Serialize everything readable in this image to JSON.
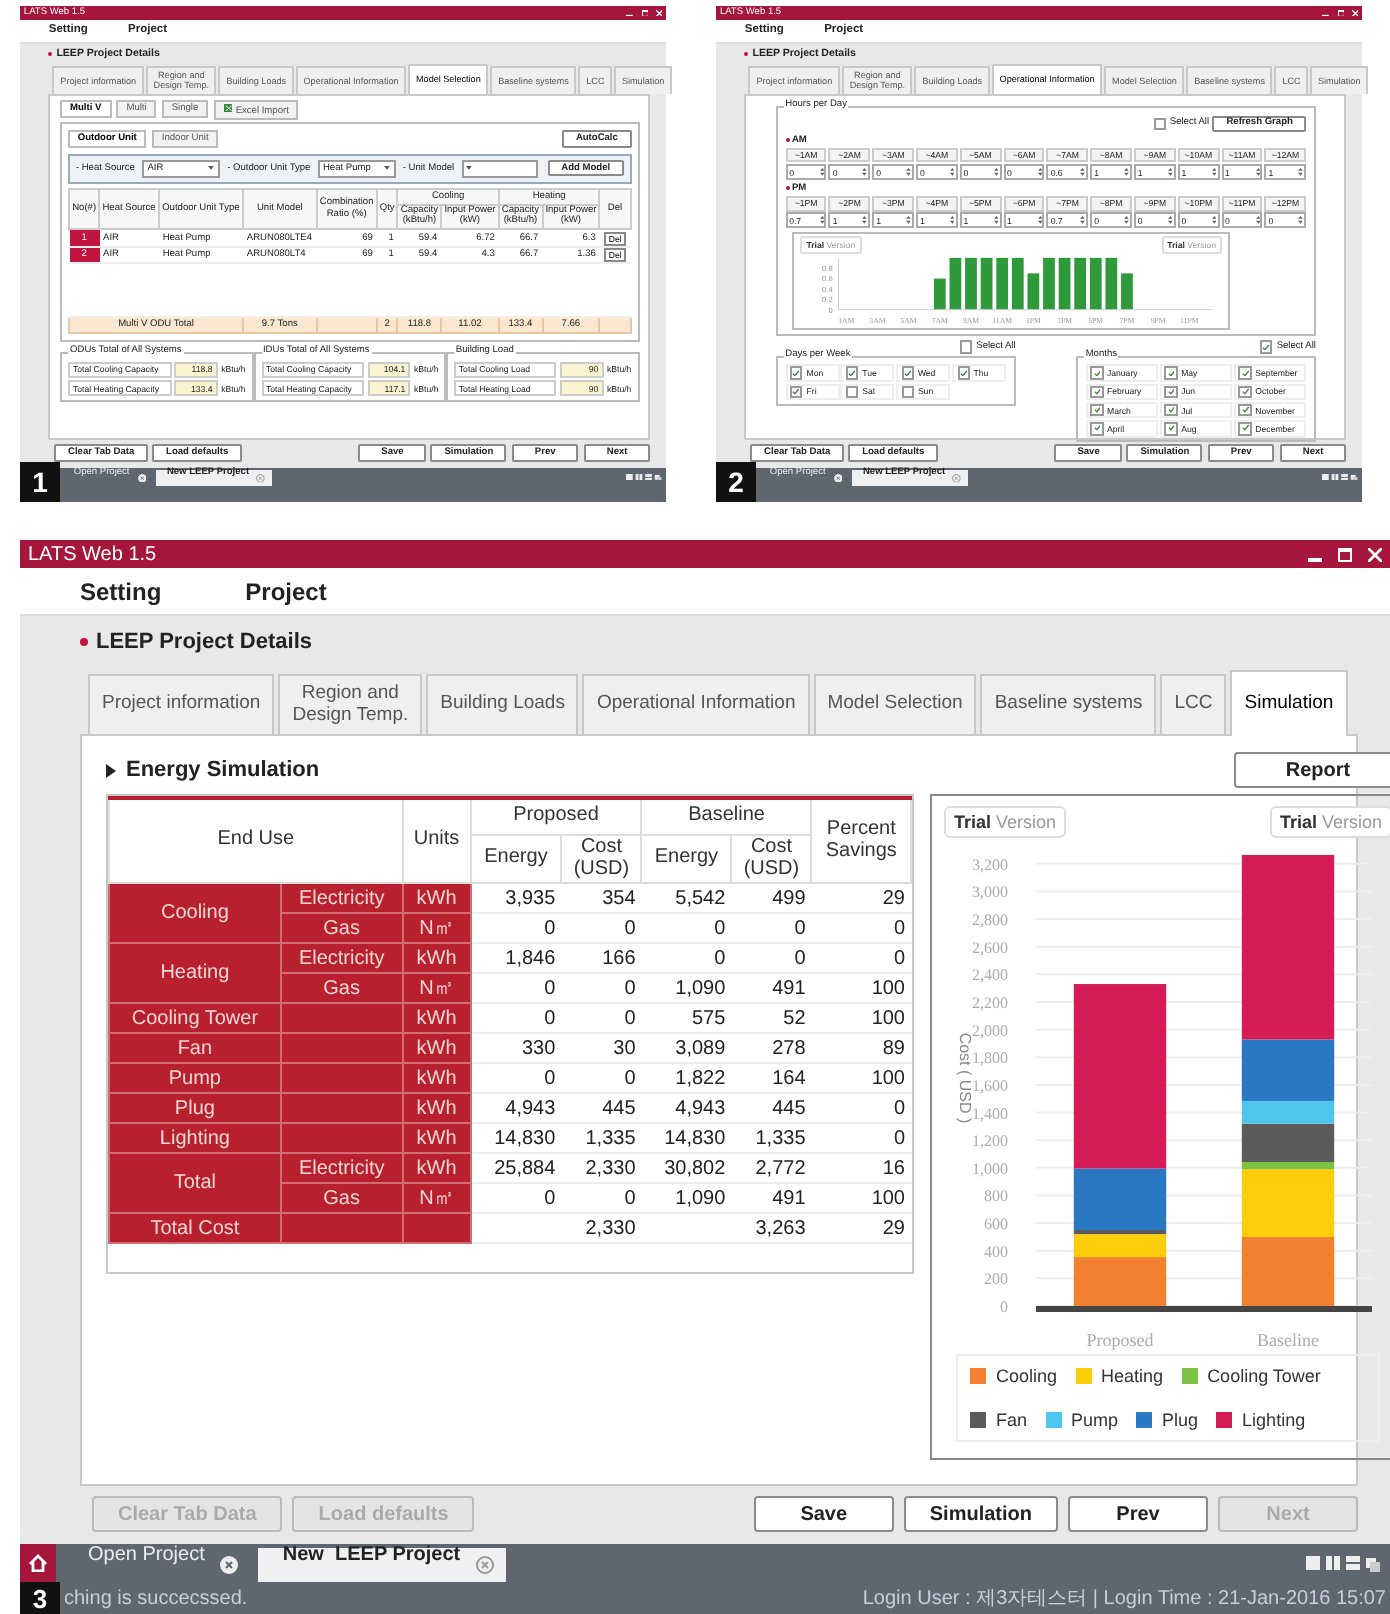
{
  "screens": [
    {
      "number": "1",
      "window": {
        "title": "LATS Web 1.5"
      },
      "menu": [
        "Setting",
        "Project"
      ],
      "section_title": "LEEP Project Details",
      "tabs": [
        {
          "label": "Project information",
          "selected": false
        },
        {
          "label": "Region and\nDesign Temp.",
          "selected": false
        },
        {
          "label": "Building Loads",
          "selected": false
        },
        {
          "label": "Operational Information",
          "selected": false
        },
        {
          "label": "Model Selection",
          "selected": true
        },
        {
          "label": "Baseline systems",
          "selected": false
        },
        {
          "label": "LCC",
          "selected": false
        },
        {
          "label": "Simulation",
          "selected": false
        }
      ],
      "content": {
        "kind": "model_selection",
        "subtabs": [
          {
            "label": "Multi V",
            "selected": true
          },
          {
            "label": "Multi",
            "selected": false
          },
          {
            "label": "Single",
            "selected": false
          }
        ],
        "excel_button": "Excel Import",
        "unit_tabs": [
          {
            "label": "Outdoor Unit",
            "selected": true
          },
          {
            "label": "Indoor Unit",
            "selected": false
          }
        ],
        "autocalc_button": "AutoCalc",
        "filters": [
          {
            "label": "- Heat Source",
            "value": "AIR"
          },
          {
            "label": "- Outdoor Unit Type",
            "value": "Heat Pump"
          },
          {
            "label": "- Unit Model"
          }
        ],
        "add_button": "Add Model",
        "columns": [
          "No(#)",
          "Heat Source",
          "Outdoor Unit Type",
          "Unit Model",
          "Combination\nRatio (%)",
          "Qty"
        ],
        "column_groups": [
          {
            "label": "Cooling",
            "columns": [
              "Capacity\n(kBtu/h)",
              "Input Power\n(kW)"
            ]
          },
          {
            "label": "Heating",
            "columns": [
              "Capacity\n(kBtu/h)",
              "Input Power\n(kW)"
            ]
          }
        ],
        "del_column": "Del",
        "rows": [
          {
            "cells": [
              "1",
              "AIR",
              "Heat Pump",
              "ARUN080LTE4",
              "69",
              "1",
              "59.4",
              "6.72",
              "66.7",
              "6.3"
            ],
            "action": "Del"
          },
          {
            "cells": [
              "2",
              "AIR",
              "Heat Pump",
              "ARUN080LT4",
              "69",
              "1",
              "59.4",
              "4.3",
              "66.7",
              "1.36"
            ],
            "action": "Del"
          }
        ],
        "total": {
          "label": "Multi V  ODU  Total",
          "unit_model": "9.7 Tons",
          "qty": "2",
          "cooling_capacity": "118.8",
          "cooling_power": "11.02",
          "heating_capacity": "133.4",
          "heating_power": "7.66"
        },
        "summaries": [
          {
            "title": "ODUs Total of All Systems",
            "fields": [
              {
                "label": "Total Cooling Capacity",
                "value": "118.8",
                "unit": "kBtu/h"
              },
              {
                "label": "Total Heating Capacity",
                "value": "133.4",
                "unit": "kBtu/h"
              }
            ]
          },
          {
            "title": "IDUs Total of All Systems",
            "fields": [
              {
                "label": "Total Cooling Capacity",
                "value": "104.1",
                "unit": "kBtu/h"
              },
              {
                "label": "Total Heating Capacity",
                "value": "117.1",
                "unit": "kBtu/h"
              }
            ]
          },
          {
            "title": "Building Load",
            "fields": [
              {
                "label": "Total Cooling Load",
                "value": "90",
                "unit": "kBtu/h"
              },
              {
                "label": "Total Heating Load",
                "value": "90",
                "unit": "kBtu/h"
              }
            ]
          }
        ]
      },
      "buttons_left": [
        {
          "label": "Clear Tab Data",
          "disabled": false
        },
        {
          "label": "Load defaults",
          "disabled": false
        }
      ],
      "buttons_right": [
        {
          "label": "Save",
          "disabled": false
        },
        {
          "label": "Simulation",
          "disabled": false
        },
        {
          "label": "Prev",
          "disabled": false
        },
        {
          "label": "Next",
          "disabled": false
        }
      ],
      "taskbar": [
        {
          "label": "Open Project",
          "selected": false
        },
        {
          "label": "New LEEP Project",
          "selected": true
        }
      ]
    },
    {
      "number": "2",
      "window": {
        "title": "LATS Web 1.5"
      },
      "menu": [
        "Setting",
        "Project"
      ],
      "section_title": "LEEP Project Details",
      "tabs": [
        {
          "label": "Project information",
          "selected": false
        },
        {
          "label": "Region and\nDesign Temp.",
          "selected": false
        },
        {
          "label": "Building Loads",
          "selected": false
        },
        {
          "label": "Operational Information",
          "selected": true
        },
        {
          "label": "Model Selection",
          "selected": false
        },
        {
          "label": "Baseline systems",
          "selected": false
        },
        {
          "label": "LCC",
          "selected": false
        },
        {
          "label": "Simulation",
          "selected": false
        }
      ],
      "content": {
        "kind": "operational",
        "hours_title": "Hours per Day",
        "select_all": {
          "label": "Select All",
          "checked": false
        },
        "refresh_button": "Refresh Graph",
        "periods": [
          {
            "label": "AM",
            "hours": [
              {
                "label": "~1AM",
                "value": "0"
              },
              {
                "label": "~2AM",
                "value": "0"
              },
              {
                "label": "~3AM",
                "value": "0"
              },
              {
                "label": "~4AM",
                "value": "0"
              },
              {
                "label": "~5AM",
                "value": "0"
              },
              {
                "label": "~6AM",
                "value": "0"
              },
              {
                "label": "~7AM",
                "value": "0.6"
              },
              {
                "label": "~8AM",
                "value": "1"
              },
              {
                "label": "~9AM",
                "value": "1"
              },
              {
                "label": "~10AM",
                "value": "1"
              },
              {
                "label": "~11AM",
                "value": "1"
              },
              {
                "label": "~12AM",
                "value": "1"
              }
            ]
          },
          {
            "label": "PM",
            "hours": [
              {
                "label": "~1PM",
                "value": "0.7"
              },
              {
                "label": "~2PM",
                "value": "1"
              },
              {
                "label": "~3PM",
                "value": "1"
              },
              {
                "label": "~4PM",
                "value": "1"
              },
              {
                "label": "~5PM",
                "value": "1"
              },
              {
                "label": "~6PM",
                "value": "1"
              },
              {
                "label": "~7PM",
                "value": "0.7"
              },
              {
                "label": "~8PM",
                "value": "0"
              },
              {
                "label": "~9PM",
                "value": "0"
              },
              {
                "label": "~10PM",
                "value": "0"
              },
              {
                "label": "~11PM",
                "value": "0"
              },
              {
                "label": "~12PM",
                "value": "0"
              }
            ]
          }
        ],
        "trial_badges": [
          "**Trial** Version",
          "**Trial** Version"
        ],
        "chart_data": {
          "type": "bar",
          "categories": [
            "1AM",
            null,
            "3AM",
            null,
            "5AM",
            null,
            "7AM",
            null,
            "9AM",
            null,
            "11AM",
            null,
            "1PM",
            null,
            "3PM",
            null,
            "5PM",
            null,
            "7PM",
            null,
            "9PM",
            null,
            "11PM",
            null
          ],
          "series": [
            {
              "color": "#2e9a3a",
              "values": [
                0,
                0,
                0,
                0,
                0,
                0,
                0.6,
                1,
                1,
                1,
                1,
                1,
                0.7,
                1,
                1,
                1,
                1,
                1,
                0.7,
                0,
                0,
                0,
                0,
                0
              ]
            }
          ],
          "ylim": [
            0,
            1
          ],
          "yticks": [
            0,
            0.2,
            0.4,
            0.6,
            0.8
          ]
        },
        "days": {
          "title": "Days per Week",
          "select_all": {
            "label": "Select All",
            "checked": false
          },
          "items": [
            {
              "label": "Mon",
              "checked": true
            },
            {
              "label": "Tue",
              "checked": true
            },
            {
              "label": "Wed",
              "checked": true
            },
            {
              "label": "Thu",
              "checked": true
            },
            {
              "label": "Fri",
              "checked": true
            },
            {
              "label": "Sat",
              "checked": false
            },
            {
              "label": "Sun",
              "checked": false
            }
          ]
        },
        "months": {
          "title": "Months",
          "select_all": {
            "label": "Select All",
            "checked": true
          },
          "items": [
            {
              "label": "January",
              "checked": true
            },
            {
              "label": "February",
              "checked": true
            },
            {
              "label": "March",
              "checked": true
            },
            {
              "label": "April",
              "checked": true
            },
            {
              "label": "May",
              "checked": true
            },
            {
              "label": "Jun",
              "checked": true
            },
            {
              "label": "Jul",
              "checked": true
            },
            {
              "label": "Aug",
              "checked": true
            },
            {
              "label": "September",
              "checked": true
            },
            {
              "label": "October",
              "checked": true
            },
            {
              "label": "November",
              "checked": true
            },
            {
              "label": "December",
              "checked": true
            }
          ]
        }
      },
      "buttons_left": [
        {
          "label": "Clear Tab Data",
          "disabled": false
        },
        {
          "label": "Load defaults",
          "disabled": false
        }
      ],
      "buttons_right": [
        {
          "label": "Save",
          "disabled": false
        },
        {
          "label": "Simulation",
          "disabled": false
        },
        {
          "label": "Prev",
          "disabled": false
        },
        {
          "label": "Next",
          "disabled": false
        }
      ],
      "taskbar": [
        {
          "label": "Open Project",
          "selected": false
        },
        {
          "label": "New LEEP Project",
          "selected": true
        }
      ]
    },
    {
      "number": "3",
      "window": {
        "title": "LATS Web 1.5"
      },
      "menu": [
        "Setting",
        "Project"
      ],
      "section_title": "LEEP Project Details",
      "tabs": [
        {
          "label": "Project information",
          "selected": false
        },
        {
          "label": "Region and\nDesign Temp.",
          "selected": false
        },
        {
          "label": "Building Loads",
          "selected": false
        },
        {
          "label": "Operational Information",
          "selected": false
        },
        {
          "label": "Model Selection",
          "selected": false
        },
        {
          "label": "Baseline systems",
          "selected": false
        },
        {
          "label": "LCC",
          "selected": false
        },
        {
          "label": "Simulation",
          "selected": true
        }
      ],
      "content": {
        "kind": "simulation",
        "title": "Energy Simulation",
        "report_button": "Report",
        "header": {
          "end_use": "End Use",
          "units": "Units",
          "groups": [
            {
              "label": "Proposed",
              "columns": [
                "Energy",
                "Cost\n(USD)"
              ]
            },
            {
              "label": "Baseline",
              "columns": [
                "Energy",
                "Cost\n(USD)"
              ]
            }
          ],
          "savings": "Percent\nSavings"
        },
        "groups": [
          {
            "end_use": "Cooling",
            "rows": [
              {
                "source": "Electricity",
                "unit": "kWh",
                "values": {
                  "proposed_energy": "3,935",
                  "proposed_cost": "354",
                  "baseline_energy": "5,542",
                  "baseline_cost": "499",
                  "savings": "29"
                }
              },
              {
                "source": "Gas",
                "unit": "N㎥",
                "values": {
                  "proposed_energy": "0",
                  "proposed_cost": "0",
                  "baseline_energy": "0",
                  "baseline_cost": "0",
                  "savings": "0"
                }
              }
            ]
          },
          {
            "end_use": "Heating",
            "rows": [
              {
                "source": "Electricity",
                "unit": "kWh",
                "values": {
                  "proposed_energy": "1,846",
                  "proposed_cost": "166",
                  "baseline_energy": "0",
                  "baseline_cost": "0",
                  "savings": "0"
                }
              },
              {
                "source": "Gas",
                "unit": "N㎥",
                "values": {
                  "proposed_energy": "0",
                  "proposed_cost": "0",
                  "baseline_energy": "1,090",
                  "baseline_cost": "491",
                  "savings": "100"
                }
              }
            ]
          },
          {
            "end_use": "Cooling Tower",
            "rows": [
              {
                "unit": "kWh",
                "values": {
                  "proposed_energy": "0",
                  "proposed_cost": "0",
                  "baseline_energy": "575",
                  "baseline_cost": "52",
                  "savings": "100"
                }
              }
            ]
          },
          {
            "end_use": "Fan",
            "rows": [
              {
                "unit": "kWh",
                "values": {
                  "proposed_energy": "330",
                  "proposed_cost": "30",
                  "baseline_energy": "3,089",
                  "baseline_cost": "278",
                  "savings": "89"
                }
              }
            ]
          },
          {
            "end_use": "Pump",
            "rows": [
              {
                "unit": "kWh",
                "values": {
                  "proposed_energy": "0",
                  "proposed_cost": "0",
                  "baseline_energy": "1,822",
                  "baseline_cost": "164",
                  "savings": "100"
                }
              }
            ]
          },
          {
            "end_use": "Plug",
            "rows": [
              {
                "unit": "kWh",
                "values": {
                  "proposed_energy": "4,943",
                  "proposed_cost": "445",
                  "baseline_energy": "4,943",
                  "baseline_cost": "445",
                  "savings": "0"
                }
              }
            ]
          },
          {
            "end_use": "Lighting",
            "rows": [
              {
                "unit": "kWh",
                "values": {
                  "proposed_energy": "14,830",
                  "proposed_cost": "1,335",
                  "baseline_energy": "14,830",
                  "baseline_cost": "1,335",
                  "savings": "0"
                }
              }
            ]
          },
          {
            "end_use": "Total",
            "rows": [
              {
                "source": "Electricity",
                "unit": "kWh",
                "values": {
                  "proposed_energy": "25,884",
                  "proposed_cost": "2,330",
                  "baseline_energy": "30,802",
                  "baseline_cost": "2,772",
                  "savings": "16"
                }
              },
              {
                "source": "Gas",
                "unit": "N㎥",
                "values": {
                  "proposed_energy": "0",
                  "proposed_cost": "0",
                  "baseline_energy": "1,090",
                  "baseline_cost": "491",
                  "savings": "100"
                }
              }
            ]
          },
          {
            "end_use": "Total Cost",
            "rows": [
              {
                "values": {
                  "proposed_cost": "2,330",
                  "baseline_cost": "3,263",
                  "savings": "29"
                }
              }
            ]
          }
        ],
        "trial_badges": [
          "**Trial** Version",
          "**Trial** Version"
        ],
        "chart_data": {
          "type": "bar",
          "stacked": true,
          "grid": true,
          "legend": "bottom",
          "ylabel": "Cost ( USD )",
          "categories": [
            "Proposed",
            "Baseline"
          ],
          "series": [
            {
              "name": "Cooling",
              "color": "#f28230",
              "values": [
                354,
                499
              ]
            },
            {
              "name": "Heating",
              "color": "#fdcd0a",
              "values": [
                166,
                491
              ]
            },
            {
              "name": "Cooling Tower",
              "color": "#7cc242",
              "values": [
                0,
                52
              ]
            },
            {
              "name": "Fan",
              "color": "#5b5b5b",
              "values": [
                30,
                278
              ]
            },
            {
              "name": "Pump",
              "color": "#4fc6f0",
              "values": [
                0,
                164
              ]
            },
            {
              "name": "Plug",
              "color": "#2b78c2",
              "values": [
                445,
                445
              ]
            },
            {
              "name": "Lighting",
              "color": "#d51c57",
              "values": [
                1335,
                1335
              ]
            }
          ],
          "ylim": [
            0,
            3300
          ],
          "yticks": [
            0,
            {
              "value": 200,
              "label": "200"
            },
            {
              "value": 400,
              "label": "400"
            },
            {
              "value": 600,
              "label": "600"
            },
            {
              "value": 800,
              "label": "800"
            },
            {
              "value": 1000,
              "label": "1,000"
            },
            {
              "value": 1200,
              "label": "1,200"
            },
            {
              "value": 1400,
              "label": "1,400"
            },
            {
              "value": 1600,
              "label": "1,600"
            },
            {
              "value": 1800,
              "label": "1,800"
            },
            {
              "value": 2000,
              "label": "2,000"
            },
            {
              "value": 2200,
              "label": "2,200"
            },
            {
              "value": 2400,
              "label": "2,400"
            },
            {
              "value": 2600,
              "label": "2,600"
            },
            {
              "value": 2800,
              "label": "2,800"
            },
            {
              "value": 3000,
              "label": "3,000"
            },
            {
              "value": 3200,
              "label": "3,200"
            }
          ]
        }
      },
      "buttons_left": [
        {
          "label": "Clear Tab Data",
          "disabled": true
        },
        {
          "label": "Load defaults",
          "disabled": true
        }
      ],
      "buttons_right": [
        {
          "label": "Save",
          "disabled": false
        },
        {
          "label": "Simulation",
          "disabled": false
        },
        {
          "label": "Prev",
          "disabled": false
        },
        {
          "label": "Next",
          "disabled": true
        }
      ],
      "taskbar": [
        {
          "label": "Open Project",
          "selected": false
        },
        {
          "label": "New  LEEP Project",
          "selected": true
        }
      ],
      "status": {
        "message": "ching is succecssed.",
        "login": "Login User : 제3자테스터 | Login Time : 21-Jan-2016 15:07"
      }
    }
  ]
}
